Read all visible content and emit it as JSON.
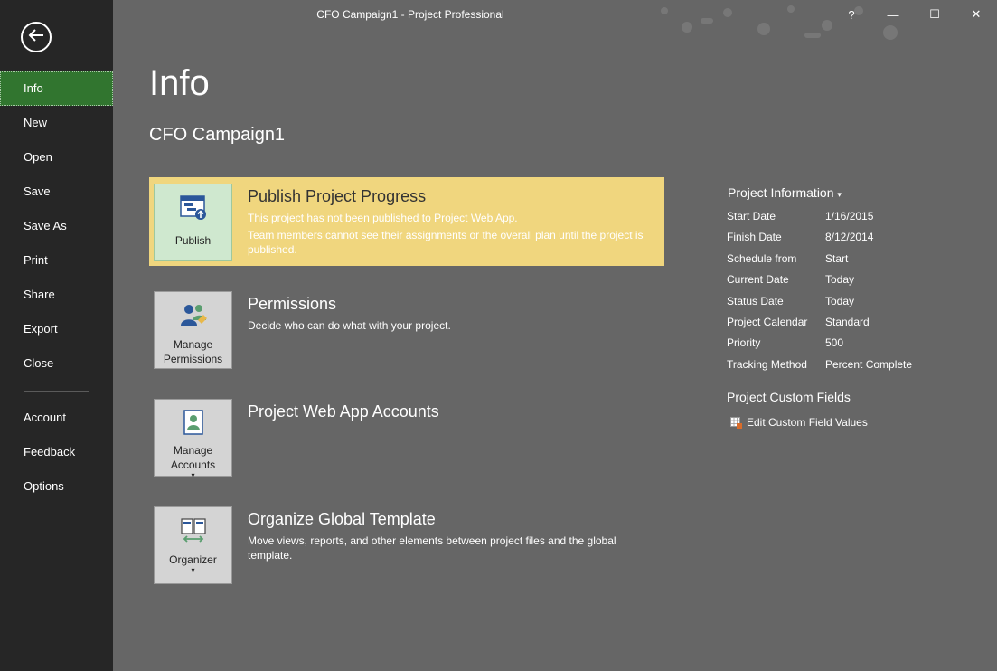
{
  "window": {
    "title": "CFO Campaign1  -  Project Professional",
    "help": "?",
    "minimize": "—",
    "maximize": "☐",
    "close": "✕"
  },
  "sidebar": {
    "back_icon": "back-arrow-icon",
    "items": [
      {
        "label": "Info",
        "active": true
      },
      {
        "label": "New"
      },
      {
        "label": "Open"
      },
      {
        "label": "Save"
      },
      {
        "label": "Save As"
      },
      {
        "label": "Print"
      },
      {
        "label": "Share"
      },
      {
        "label": "Export"
      },
      {
        "label": "Close"
      }
    ],
    "bottom_items": [
      {
        "label": "Account"
      },
      {
        "label": "Feedback"
      },
      {
        "label": "Options"
      }
    ]
  },
  "main": {
    "title": "Info",
    "file_name": "CFO Campaign1",
    "sections": {
      "publish": {
        "tile_label": "Publish",
        "title": "Publish Project Progress",
        "desc_1": "This project has not been published to Project Web App.",
        "desc_2": "Team members cannot see their assignments or the overall plan until the project is published."
      },
      "permissions": {
        "tile_label": "Manage Permissions",
        "title": "Permissions",
        "desc": "Decide who can do what with your project."
      },
      "accounts": {
        "tile_label": "Manage Accounts",
        "tile_caret": "▾",
        "title": "Project Web App Accounts"
      },
      "organizer": {
        "tile_label": "Organizer",
        "tile_caret": "▾",
        "title": "Organize Global Template",
        "desc": "Move views, reports, and other elements between project files and the global template."
      }
    }
  },
  "project_info": {
    "heading": "Project Information",
    "heading_caret": "▾",
    "rows": [
      {
        "key": "Start Date",
        "value": "1/16/2015"
      },
      {
        "key": "Finish Date",
        "value": "8/12/2014"
      },
      {
        "key": "Schedule from",
        "value": "Start"
      },
      {
        "key": "Current Date",
        "value": "Today"
      },
      {
        "key": "Status Date",
        "value": "Today"
      },
      {
        "key": "Project Calendar",
        "value": "Standard"
      },
      {
        "key": "Priority",
        "value": "500"
      },
      {
        "key": "Tracking Method",
        "value": "Percent Complete"
      }
    ]
  },
  "custom_fields": {
    "heading": "Project Custom Fields",
    "link": "Edit Custom Field Values"
  },
  "colors": {
    "sidebar_bg": "#262626",
    "active_item": "#31752f",
    "main_bg": "#666666",
    "highlight": "#f0d67e"
  }
}
